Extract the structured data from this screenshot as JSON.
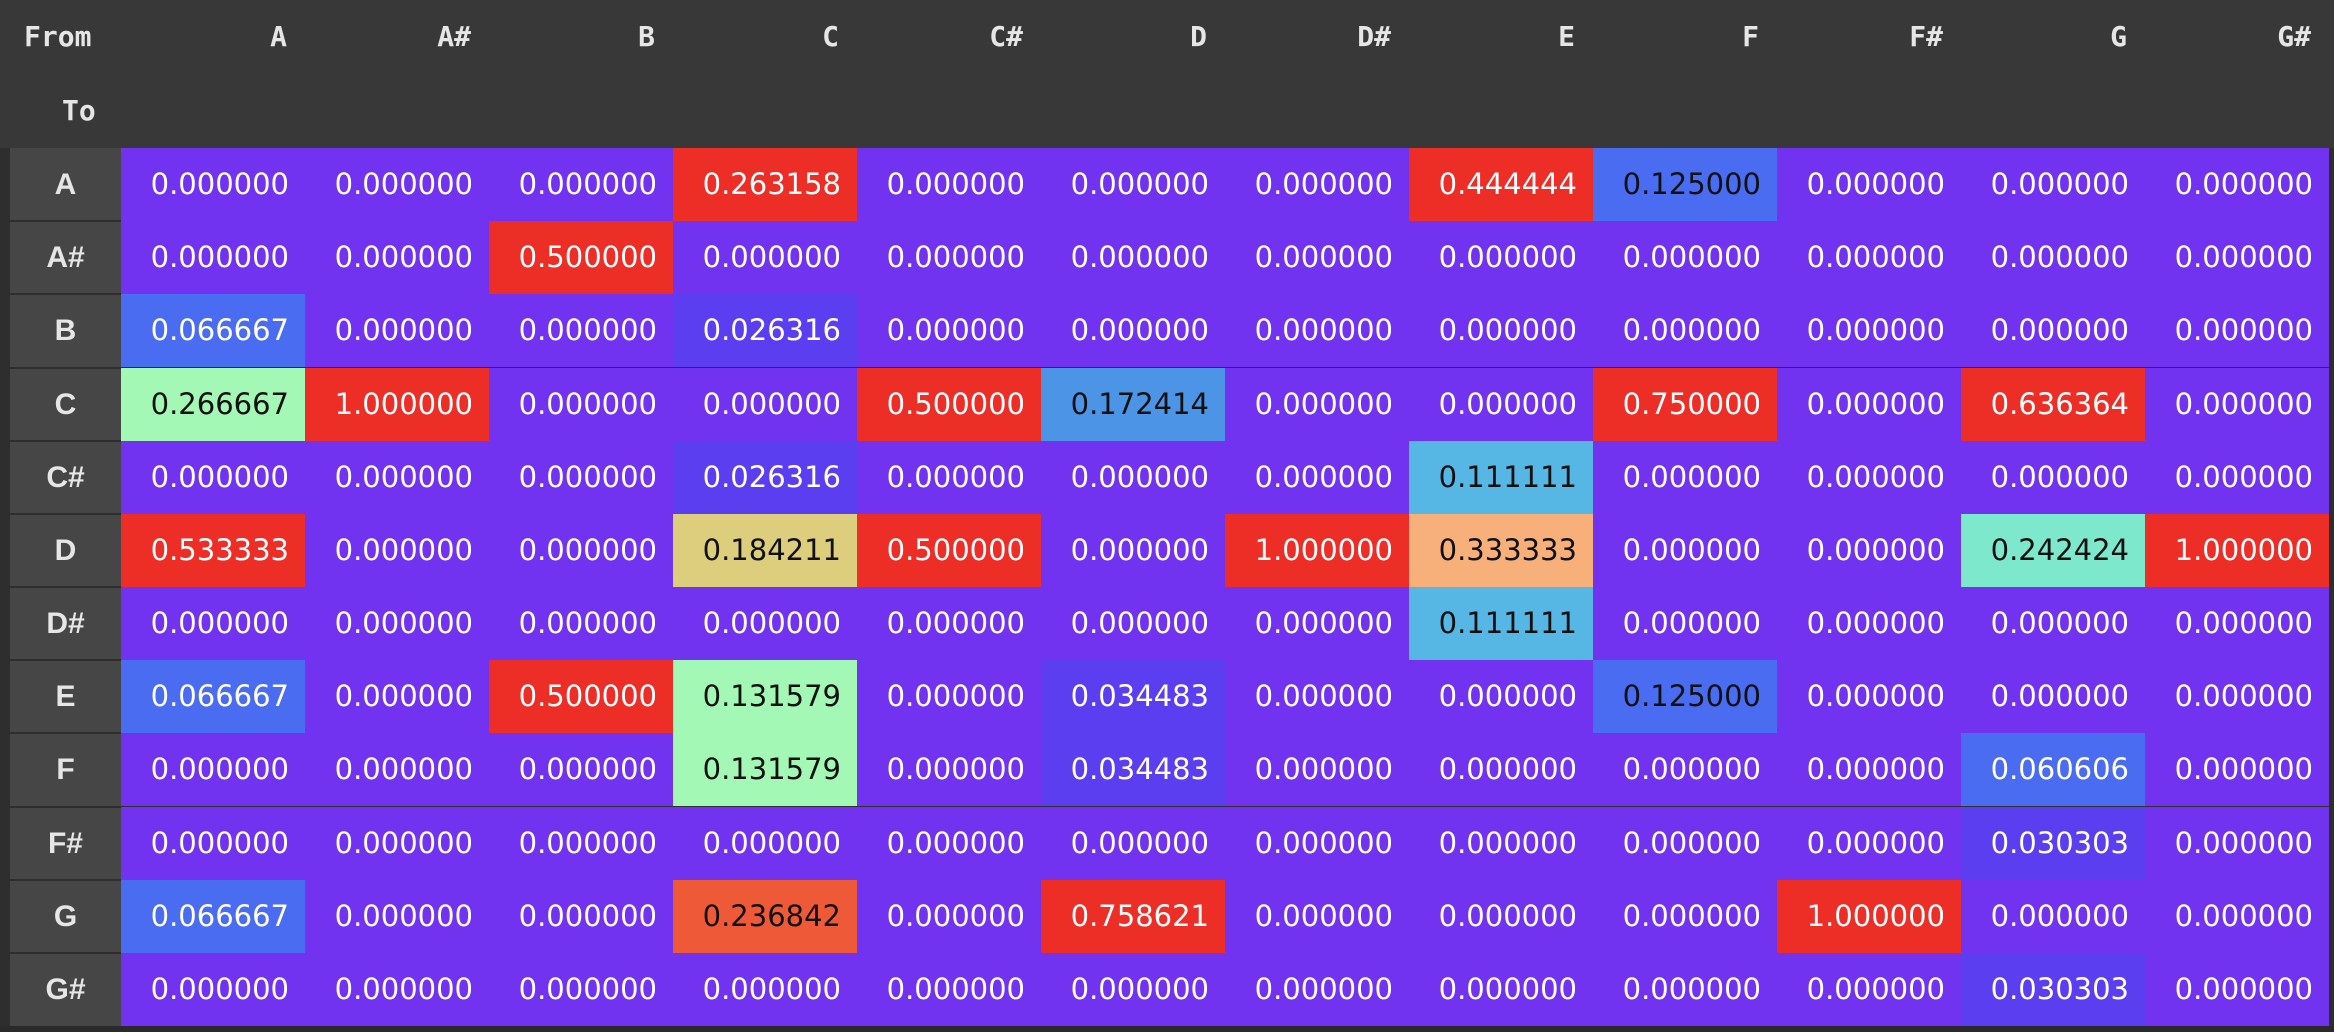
{
  "corner": {
    "from_label": "From",
    "to_label": "To"
  },
  "chart_data": {
    "type": "heatmap",
    "title": "",
    "columns": [
      "A",
      "A#",
      "B",
      "C",
      "C#",
      "D",
      "D#",
      "E",
      "F",
      "F#",
      "G",
      "G#"
    ],
    "rows": [
      "A",
      "A#",
      "B",
      "C",
      "C#",
      "D",
      "D#",
      "E",
      "F",
      "F#",
      "G",
      "G#"
    ],
    "values": [
      [
        "0.000000",
        "0.000000",
        "0.000000",
        "0.263158",
        "0.000000",
        "0.000000",
        "0.000000",
        "0.444444",
        "0.125000",
        "0.000000",
        "0.000000",
        "0.000000"
      ],
      [
        "0.000000",
        "0.000000",
        "0.500000",
        "0.000000",
        "0.000000",
        "0.000000",
        "0.000000",
        "0.000000",
        "0.000000",
        "0.000000",
        "0.000000",
        "0.000000"
      ],
      [
        "0.066667",
        "0.000000",
        "0.000000",
        "0.026316",
        "0.000000",
        "0.000000",
        "0.000000",
        "0.000000",
        "0.000000",
        "0.000000",
        "0.000000",
        "0.000000"
      ],
      [
        "0.266667",
        "1.000000",
        "0.000000",
        "0.000000",
        "0.500000",
        "0.172414",
        "0.000000",
        "0.000000",
        "0.750000",
        "0.000000",
        "0.636364",
        "0.000000"
      ],
      [
        "0.000000",
        "0.000000",
        "0.000000",
        "0.026316",
        "0.000000",
        "0.000000",
        "0.000000",
        "0.111111",
        "0.000000",
        "0.000000",
        "0.000000",
        "0.000000"
      ],
      [
        "0.533333",
        "0.000000",
        "0.000000",
        "0.184211",
        "0.500000",
        "0.000000",
        "1.000000",
        "0.333333",
        "0.000000",
        "0.000000",
        "0.242424",
        "1.000000"
      ],
      [
        "0.000000",
        "0.000000",
        "0.000000",
        "0.000000",
        "0.000000",
        "0.000000",
        "0.000000",
        "0.111111",
        "0.000000",
        "0.000000",
        "0.000000",
        "0.000000"
      ],
      [
        "0.066667",
        "0.000000",
        "0.500000",
        "0.131579",
        "0.000000",
        "0.034483",
        "0.000000",
        "0.000000",
        "0.125000",
        "0.000000",
        "0.000000",
        "0.000000"
      ],
      [
        "0.000000",
        "0.000000",
        "0.000000",
        "0.131579",
        "0.000000",
        "0.034483",
        "0.000000",
        "0.000000",
        "0.000000",
        "0.000000",
        "0.060606",
        "0.000000"
      ],
      [
        "0.000000",
        "0.000000",
        "0.000000",
        "0.000000",
        "0.000000",
        "0.000000",
        "0.000000",
        "0.000000",
        "0.000000",
        "0.000000",
        "0.030303",
        "0.000000"
      ],
      [
        "0.066667",
        "0.000000",
        "0.000000",
        "0.236842",
        "0.000000",
        "0.758621",
        "0.000000",
        "0.000000",
        "0.000000",
        "1.000000",
        "0.000000",
        "0.000000"
      ],
      [
        "0.000000",
        "0.000000",
        "0.000000",
        "0.000000",
        "0.000000",
        "0.000000",
        "0.000000",
        "0.000000",
        "0.000000",
        "0.000000",
        "0.030303",
        "0.000000"
      ]
    ],
    "colormap": {
      "zero": "#7233f1",
      "low": "#5a3ef0",
      "blue": "#4a6cf0",
      "mid_blue": "#4c94e6",
      "cyan": "#56b6e4",
      "aqua": "#7de8cc",
      "mint": "#a2f8b4",
      "yellow": "#dcce7c",
      "orange": "#f8b07a",
      "red_orange": "#ee5a38",
      "red": "#ec2e26"
    },
    "text_colors": {
      "light": "#ffffff",
      "dark": "#111111"
    }
  }
}
